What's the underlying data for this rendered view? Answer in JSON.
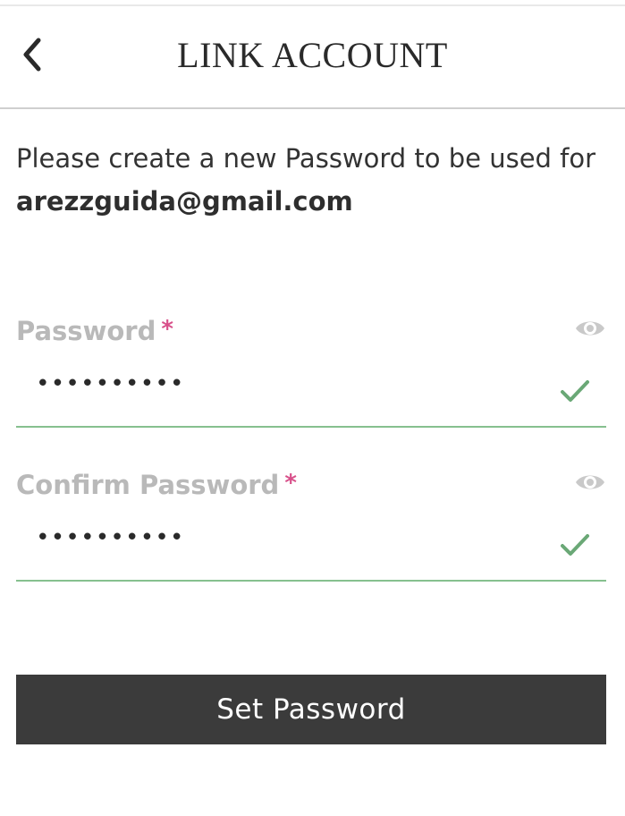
{
  "header": {
    "title": "LINK ACCOUNT",
    "back_icon": "chevron-left-icon"
  },
  "instruction": {
    "text": "Please create a new Password to be used for",
    "email": "arezzguida@gmail.com"
  },
  "fields": {
    "password": {
      "label": "Password",
      "required_mark": "*",
      "value_masked": "••••••••••",
      "visibility_icon": "eye-icon",
      "status_icon": "check-icon"
    },
    "confirm_password": {
      "label": "Confirm Password",
      "required_mark": "*",
      "value_masked": "••••••••••",
      "visibility_icon": "eye-icon",
      "status_icon": "check-icon"
    }
  },
  "actions": {
    "submit_label": "Set Password"
  },
  "colors": {
    "valid": "#6aa876",
    "required": "#d8508a",
    "label": "#b9b9b9",
    "button_bg": "#3b3b3b"
  }
}
